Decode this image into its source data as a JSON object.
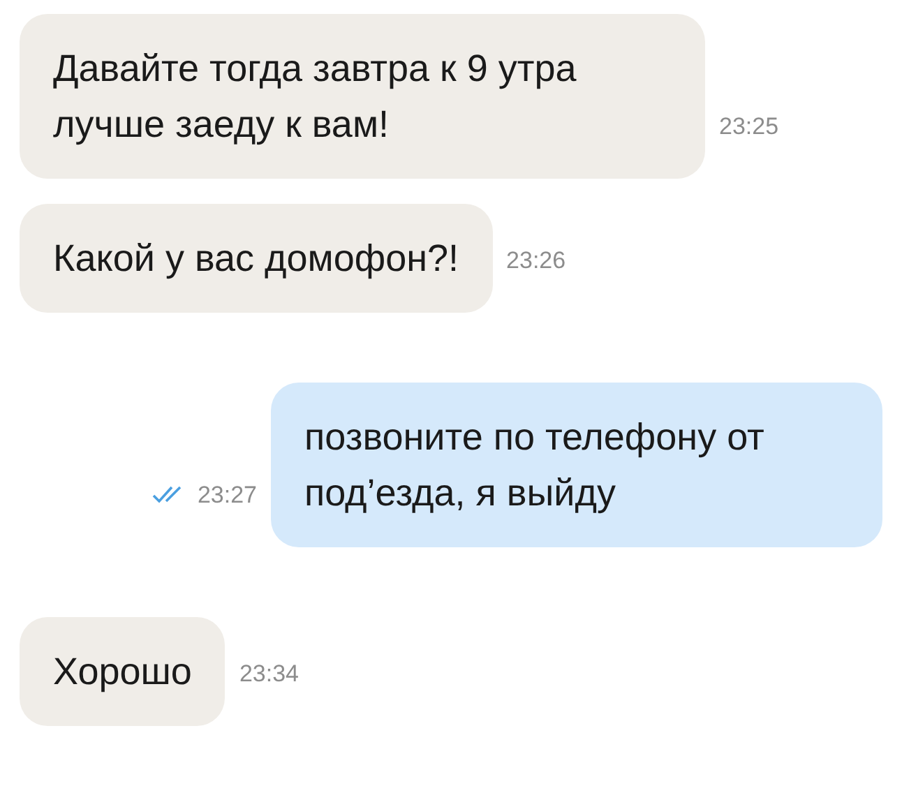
{
  "messages": [
    {
      "kind": "incoming",
      "text": "Давайте тогда завтра к 9 утра лучше заеду к вам!",
      "time": "23:25"
    },
    {
      "kind": "incoming",
      "text": "Какой у вас домофон?!",
      "time": "23:26"
    },
    {
      "kind": "outgoing",
      "text": "позвоните по телефону от под’езда, я выйду",
      "time": "23:27",
      "read": true
    },
    {
      "kind": "incoming",
      "text": "Хорошо",
      "time": "23:34"
    }
  ]
}
